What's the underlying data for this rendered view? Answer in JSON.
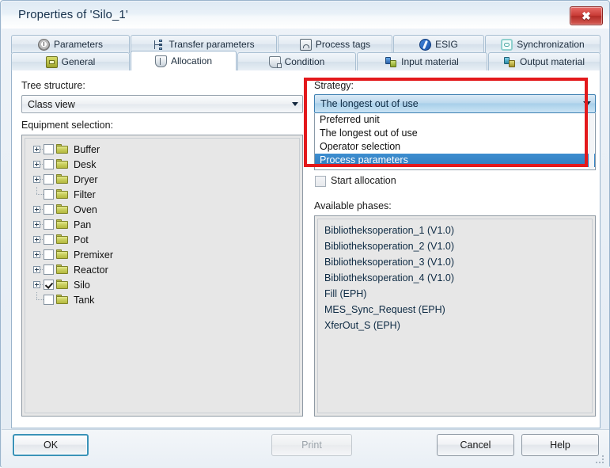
{
  "window": {
    "title": "Properties of 'Silo_1'",
    "close_label": "✖"
  },
  "tabs": {
    "row1": [
      {
        "label": "Parameters",
        "icon": "gauge-icon"
      },
      {
        "label": "Transfer parameters",
        "icon": "transfer-icon"
      },
      {
        "label": "Process tags",
        "icon": "process-tag-icon"
      },
      {
        "label": "ESIG",
        "icon": "esig-icon"
      },
      {
        "label": "Synchronization",
        "icon": "sync-icon"
      }
    ],
    "row2": [
      {
        "label": "General",
        "icon": "general-icon"
      },
      {
        "label": "Allocation",
        "icon": "shield-icon"
      },
      {
        "label": "Condition",
        "icon": "condition-icon"
      },
      {
        "label": "Input material",
        "icon": "input-material-icon"
      },
      {
        "label": "Output material",
        "icon": "output-material-icon"
      }
    ],
    "active": "Allocation"
  },
  "left_panel": {
    "tree_structure_label": "Tree structure:",
    "tree_structure_value": "Class view",
    "equipment_selection_label": "Equipment selection:",
    "tree_items": [
      {
        "name": "Buffer",
        "expandable": true,
        "checked": false
      },
      {
        "name": "Desk",
        "expandable": true,
        "checked": false
      },
      {
        "name": "Dryer",
        "expandable": true,
        "checked": false
      },
      {
        "name": "Filter",
        "expandable": false,
        "checked": false
      },
      {
        "name": "Oven",
        "expandable": true,
        "checked": false
      },
      {
        "name": "Pan",
        "expandable": true,
        "checked": false
      },
      {
        "name": "Pot",
        "expandable": true,
        "checked": false
      },
      {
        "name": "Premixer",
        "expandable": true,
        "checked": false
      },
      {
        "name": "Reactor",
        "expandable": true,
        "checked": false
      },
      {
        "name": "Silo",
        "expandable": true,
        "checked": true
      },
      {
        "name": "Tank",
        "expandable": false,
        "checked": false
      }
    ]
  },
  "right_panel": {
    "strategy_label": "Strategy:",
    "strategy_value": "The longest out of use",
    "strategy_options": [
      {
        "label": "Preferred unit",
        "selected": false
      },
      {
        "label": "The longest out of use",
        "selected": false
      },
      {
        "label": "Operator selection",
        "selected": false
      },
      {
        "label": "Process parameters",
        "selected": true
      }
    ],
    "start_allocation_label": "Start allocation",
    "start_allocation_checked": false,
    "available_phases_label": "Available phases:",
    "phases": [
      "Bibliotheksoperation_1 (V1.0)",
      "Bibliotheksoperation_2 (V1.0)",
      "Bibliotheksoperation_3 (V1.0)",
      "Bibliotheksoperation_4 (V1.0)",
      "Fill (EPH)",
      "MES_Sync_Request (EPH)",
      "XferOut_S (EPH)"
    ]
  },
  "buttons": {
    "ok": "OK",
    "print": "Print",
    "cancel": "Cancel",
    "help": "Help"
  },
  "colors": {
    "highlight_box": "#e3191c",
    "selection": "#2f7cbe",
    "close_button": "#c93c36",
    "folder": "#c9ce5e"
  }
}
